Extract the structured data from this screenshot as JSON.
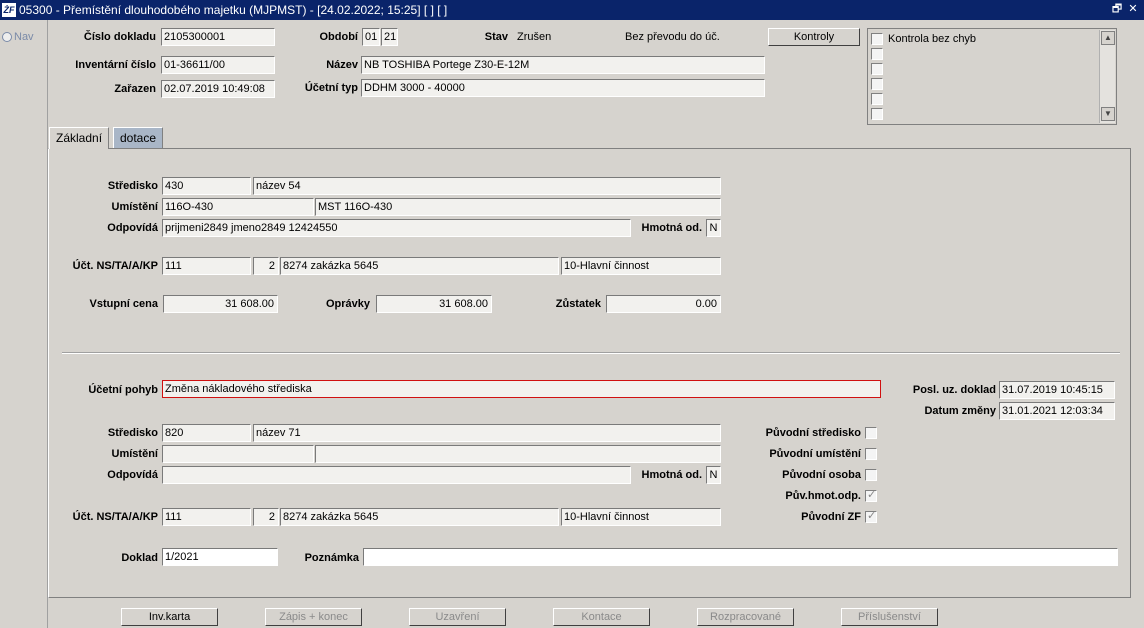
{
  "window": {
    "icon_text": "ŻF",
    "title": "05300 - Přemístění dlouhodobého majetku (MJPMST) - [24.02.2022; 15:25]  [ ]  [ ]",
    "controls": [
      "🗗",
      "✕"
    ]
  },
  "sidebar": {
    "nav_label": "Nav"
  },
  "header": {
    "cislo_dokladu_label": "Číslo dokladu",
    "cislo_dokladu": "2105300001",
    "inventarni_cislo_label": "Inventární číslo",
    "inventarni_cislo": "01-36611/00",
    "zarazen_label": "Zařazen",
    "zarazen": "02.07.2019 10:49:08",
    "obdobi_label": "Období",
    "obdobi_month": "01",
    "obdobi_year": "21",
    "stav_label": "Stav",
    "stav": "Zrušen",
    "bez_prevodu": "Bez převodu do úč.",
    "nazev_label": "Název",
    "nazev": "NB TOSHIBA Portege Z30-E-12M",
    "ucetni_typ_label": "Účetní typ",
    "ucetni_typ": "DDHM 3000 - 40000",
    "kontroly_button": "Kontroly",
    "kontrola_bez_chyb": "Kontrola bez chyb"
  },
  "tabs": [
    {
      "label": "Základní",
      "active": true
    },
    {
      "label": "dotace",
      "active": false
    }
  ],
  "original": {
    "stredisko_label": "Středisko",
    "stredisko_code": "430",
    "stredisko_name": "název 54",
    "umisteni_label": "Umístění",
    "umisteni_code": "116O-430",
    "umisteni_name": "MST 116O-430",
    "odpovida_label": "Odpovídá",
    "odpovida": "prijmeni2849 jmeno2849 12424550",
    "hmotna_label": "Hmotná od.",
    "hmotna": "N",
    "uct_label": "Účt. NS/TA/A/KP",
    "uct_ns": "111",
    "uct_ta": "2",
    "uct_a": "8274 zakázka 5645",
    "uct_kp": "10-Hlavní činnost",
    "vstupni_cena_label": "Vstupní cena",
    "vstupni_cena": "31 608.00",
    "opravky_label": "Oprávky",
    "opravky": "31 608.00",
    "zustatek_label": "Zůstatek",
    "zustatek": "0.00"
  },
  "movement": {
    "ucetni_pohyb_label": "Účetní pohyb",
    "ucetni_pohyb": "Změna nákladového střediska",
    "posl_uz_doklad_label": "Posl. uz. doklad",
    "posl_uz_doklad": "31.07.2019 10:45:15",
    "datum_zmeny_label": "Datum změny",
    "datum_zmeny": "31.01.2021 12:03:34",
    "stredisko_label": "Středisko",
    "stredisko_code": "820",
    "stredisko_name": "název 71",
    "umisteni_label": "Umístění",
    "umisteni_code": "",
    "umisteni_name": "",
    "odpovida_label": "Odpovídá",
    "odpovida": "",
    "hmotna_label": "Hmotná od.",
    "hmotna": "N",
    "uct_label": "Účt. NS/TA/A/KP",
    "uct_ns": "111",
    "uct_ta": "2",
    "uct_a": "8274 zakázka 5645",
    "uct_kp": "10-Hlavní činnost",
    "puvodni_stredisko_label": "Původní středisko",
    "puvodni_umisteni_label": "Původní umístění",
    "puvodni_osoba_label": "Původní osoba",
    "puv_hmot_odp_label": "Pův.hmot.odp.",
    "puvodni_zf_label": "Původní ZF",
    "doklad_label": "Doklad",
    "doklad": "1/2021",
    "poznamka_label": "Poznámka",
    "poznamka": ""
  },
  "buttons": {
    "inv_karta": "Inv.karta",
    "zapis_konec": "Zápis + konec",
    "uzavreni": "Uzavření",
    "kontace": "Kontace",
    "rozpracovane": "Rozpracované",
    "prislusenstvi": "Příslušenství"
  }
}
